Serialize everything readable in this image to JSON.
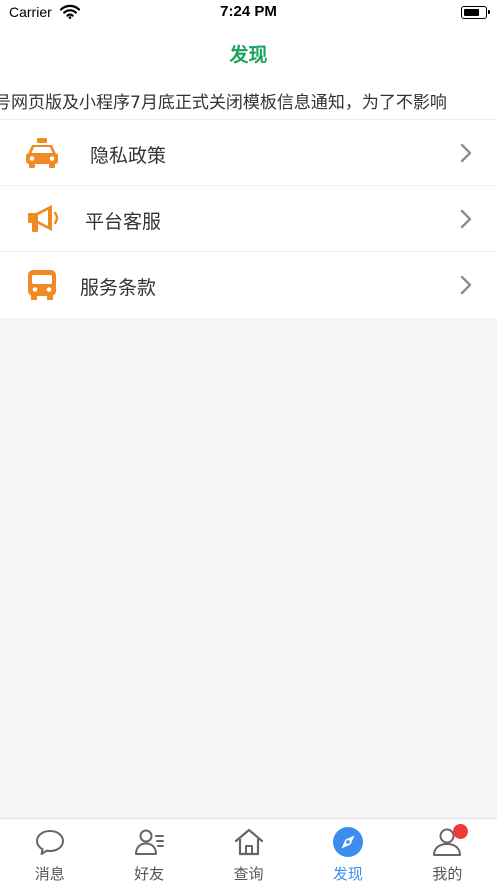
{
  "status_bar": {
    "carrier": "Carrier",
    "time": "7:24 PM"
  },
  "nav": {
    "title": "发现"
  },
  "notice": {
    "text": "号网页版及小程序7月底正式关闭模板信息通知，为了不影响"
  },
  "menu": {
    "items": [
      {
        "label": "隐私政策",
        "icon": "taxi-icon"
      },
      {
        "label": "平台客服",
        "icon": "megaphone-icon"
      },
      {
        "label": "服务条款",
        "icon": "bus-icon"
      }
    ]
  },
  "tabs": [
    {
      "label": "消息",
      "icon": "message-icon",
      "active": false
    },
    {
      "label": "好友",
      "icon": "friends-icon",
      "active": false
    },
    {
      "label": "查询",
      "icon": "home-icon",
      "active": false
    },
    {
      "label": "发现",
      "icon": "compass-icon",
      "active": true
    },
    {
      "label": "我的",
      "icon": "profile-icon",
      "active": false,
      "badge": true
    }
  ],
  "colors": {
    "accent_green": "#1aa35a",
    "icon_orange": "#f08a24",
    "tab_active": "#3b8df0",
    "badge_red": "#f03a3a"
  }
}
